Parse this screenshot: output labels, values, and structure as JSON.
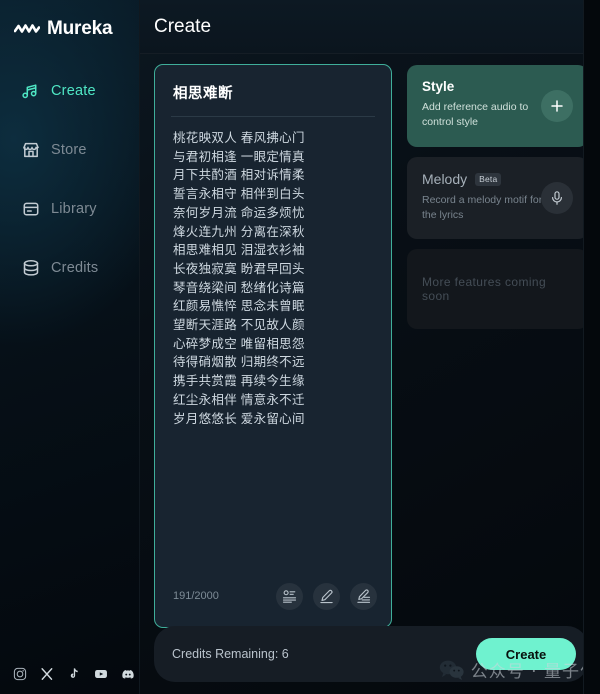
{
  "brand": {
    "name": "Mureka",
    "logo_icon": "waveform-zigzag-icon"
  },
  "sidebar": {
    "items": [
      {
        "label": "Create",
        "icon": "music-note-icon",
        "active": true
      },
      {
        "label": "Store",
        "icon": "store-icon",
        "active": false
      },
      {
        "label": "Library",
        "icon": "library-box-icon",
        "active": false
      },
      {
        "label": "Credits",
        "icon": "database-icon",
        "active": false
      }
    ],
    "social": [
      {
        "name": "instagram-icon"
      },
      {
        "name": "x-twitter-icon"
      },
      {
        "name": "tiktok-icon"
      },
      {
        "name": "youtube-icon"
      },
      {
        "name": "discord-icon"
      }
    ]
  },
  "header": {
    "title": "Create"
  },
  "lyrics": {
    "title": "相思难断",
    "lines": [
      "桃花映双人 春风拂心门",
      "与君初相逢 一眼定情真",
      "月下共酌酒 相对诉情柔",
      "誓言永相守 相伴到白头",
      "奈何岁月流 命运多烦忧",
      "烽火连九州 分离在深秋",
      "相思难相见 泪湿衣衫袖",
      "长夜独寂寞 盼君早回头",
      "琴音绕梁间 愁绪化诗篇",
      "红颜易憔悴 思念未曾眠",
      "望断天涯路 不见故人颜",
      "心碎梦成空 唯留相思怨",
      "待得硝烟散 归期终不远",
      "携手共赏霞 再续今生缘",
      "红尘永相伴 情意永不迁",
      "岁月悠悠长 爱永留心间"
    ],
    "char_count": "191/2000",
    "actions": [
      {
        "name": "lyrics-assistant-icon"
      },
      {
        "name": "edit-pencil-icon"
      },
      {
        "name": "rewrite-pencil-icon"
      }
    ]
  },
  "features": {
    "style": {
      "title": "Style",
      "subtitle": "Add reference audio to control style",
      "action_icon": "plus-icon",
      "color": "#2c5b51"
    },
    "melody": {
      "title": "Melody",
      "badge": "Beta",
      "subtitle": "Record a melody motif for the lyrics",
      "action_icon": "microphone-icon",
      "color": "#1b2026"
    },
    "coming_soon": {
      "text": "More features coming soon"
    }
  },
  "bottom": {
    "credits": "Credits Remaining: 6",
    "create_label": "Create",
    "accent": "#6ff2cf"
  },
  "watermark": {
    "text": "公众号 · 量子位",
    "icon": "wechat-icon"
  }
}
